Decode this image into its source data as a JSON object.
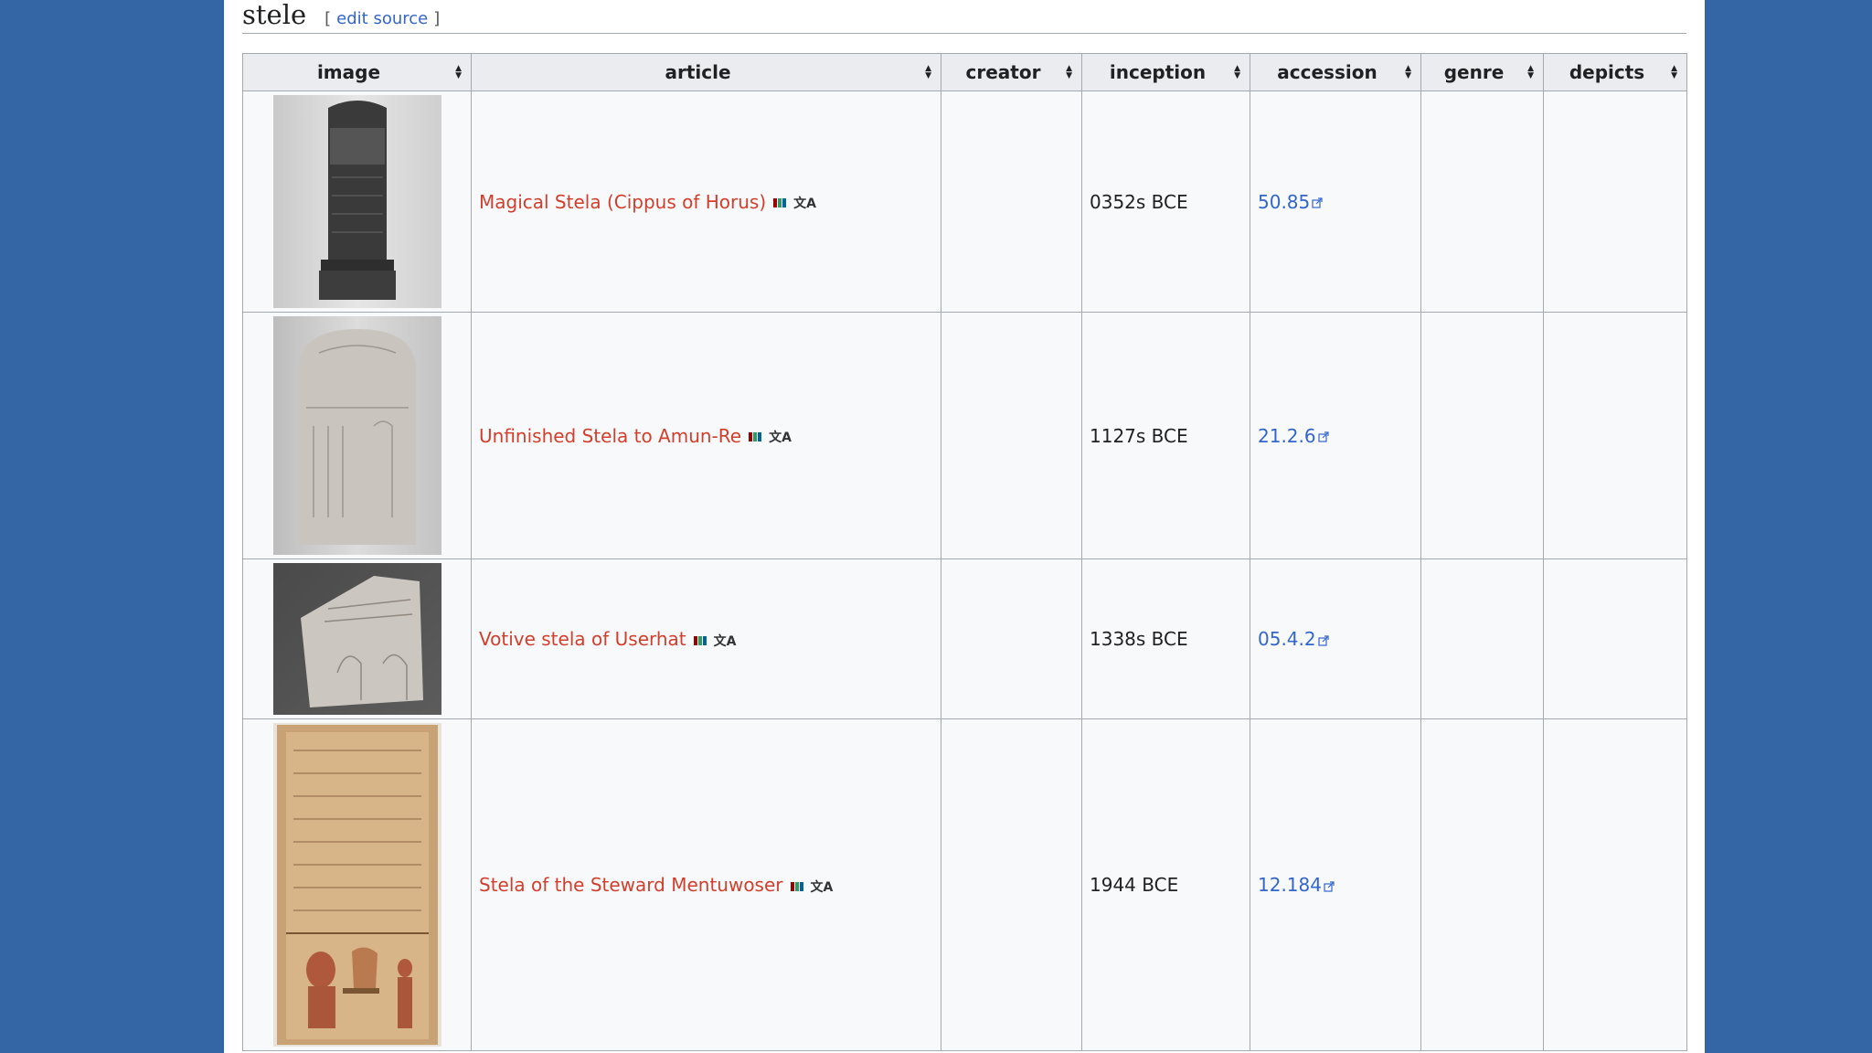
{
  "section": {
    "title": "stele",
    "edit_open": "[",
    "edit_label": "edit source",
    "edit_close": "]"
  },
  "columns": [
    "image",
    "article",
    "creator",
    "inception",
    "accession",
    "genre",
    "depicts"
  ],
  "rows": [
    {
      "article": "Magical Stela (Cippus of Horus)",
      "creator": "",
      "inception": "0352s BCE",
      "accession": "50.85",
      "genre": "",
      "depicts": ""
    },
    {
      "article": "Unfinished Stela to Amun-Re",
      "creator": "",
      "inception": "1127s BCE",
      "accession": "21.2.6",
      "genre": "",
      "depicts": ""
    },
    {
      "article": "Votive stela of Userhat",
      "creator": "",
      "inception": "1338s BCE",
      "accession": "05.4.2",
      "genre": "",
      "depicts": ""
    },
    {
      "article": "Stela of the Steward Mentuwoser",
      "creator": "",
      "inception": "1944 BCE",
      "accession": "12.184",
      "genre": "",
      "depicts": ""
    }
  ],
  "colors": {
    "page_bg": "#3465a4",
    "article_link": "#d33e2c",
    "accession_link": "#3366cc",
    "header_bg": "#eaecf0"
  },
  "icons": {
    "sort": "sort-up-down-icon",
    "wikidata": "wikidata-barcode-icon",
    "translate": "translate-icon",
    "external": "external-link-icon"
  }
}
